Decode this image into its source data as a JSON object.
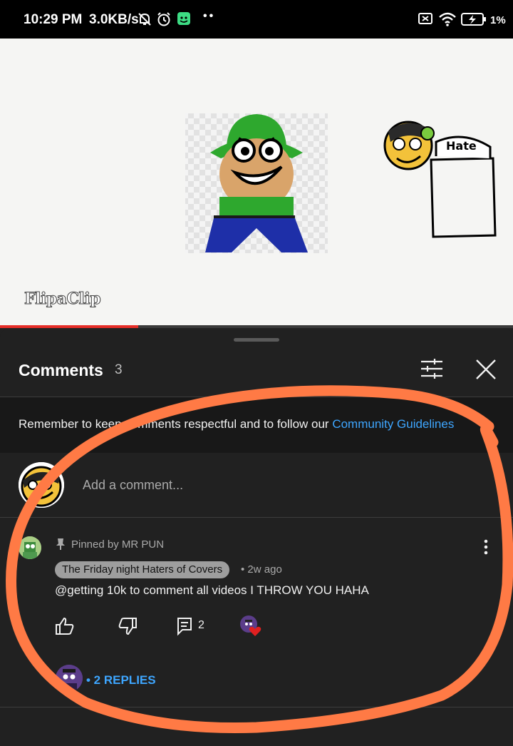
{
  "status_bar": {
    "time": "10:29 PM",
    "speed": "3.0KB/s",
    "battery_pct": "1%",
    "icons": [
      "mute-bell-icon",
      "alarm-icon",
      "app-notification-icon",
      "sim-off-icon",
      "wifi-icon",
      "battery-charging-icon"
    ]
  },
  "video": {
    "watermark": "FlipaClip",
    "sign_text": "Hate",
    "progress": 0.27,
    "progress_color": "#e52d27"
  },
  "comments_panel": {
    "title": "Comments",
    "count": "3",
    "guidelines_text": "Remember to keep comments respectful and to follow our ",
    "guidelines_link": "Community Guidelines",
    "add_comment_placeholder": "Add a comment...",
    "accent_color": "#3ea6ff"
  },
  "comment": {
    "pinned_label": "Pinned by MR PUN",
    "author": "The Friday night Haters of Covers",
    "time": "• 2w ago",
    "text": "@getting 10k to comment all videos I THROW YOU HAHA",
    "reply_count": "2",
    "replies_label": "• 2 REPLIES"
  }
}
